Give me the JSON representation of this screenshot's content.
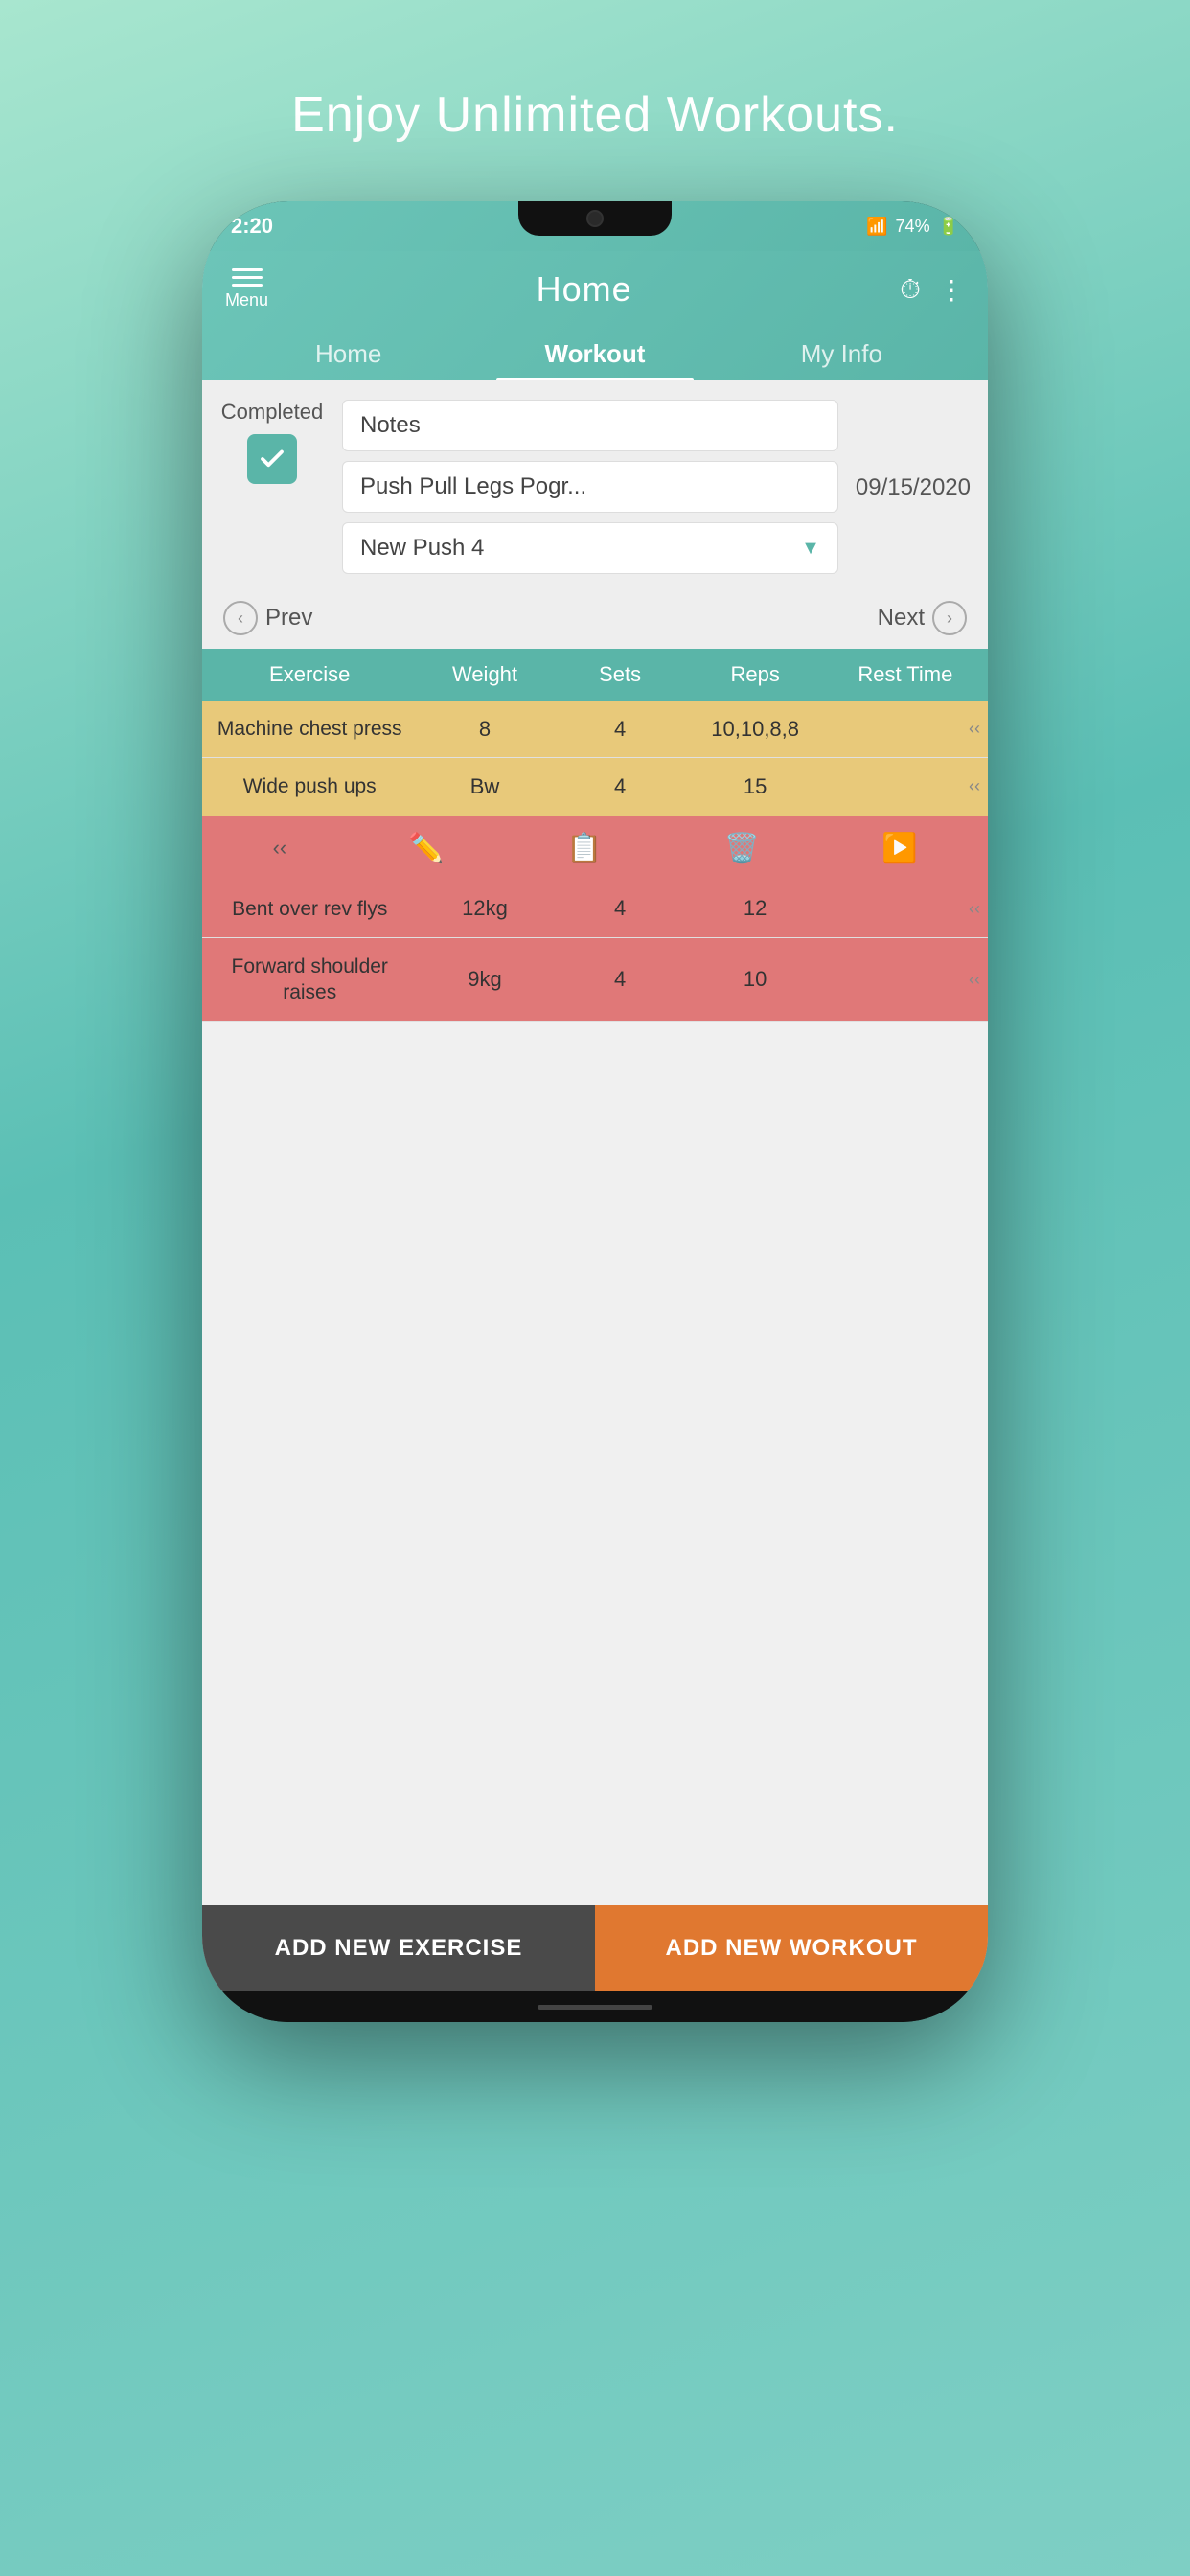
{
  "tagline": "Enjoy Unlimited Workouts.",
  "status": {
    "time": "2:20",
    "battery": "74%",
    "icons": "📶"
  },
  "header": {
    "menu_label": "Menu",
    "title": "Home",
    "timer_icon": "⏱",
    "more_icon": "⋮"
  },
  "tabs": [
    {
      "label": "Home",
      "active": false
    },
    {
      "label": "Workout",
      "active": true
    },
    {
      "label": "My Info",
      "active": false
    }
  ],
  "workout": {
    "completed_label": "Completed",
    "notes_label": "Notes",
    "program_label": "Push Pull Legs Pogr...",
    "workout_name": "New Push 4",
    "date": "09/15/2020",
    "prev_label": "Prev",
    "next_label": "Next"
  },
  "table": {
    "headers": [
      "Exercise",
      "Weight",
      "Sets",
      "Reps",
      "Rest Time"
    ],
    "rows": [
      {
        "exercise": "Machine chest press",
        "weight": "8",
        "sets": "4",
        "reps": "10,10,8,8",
        "color": "yellow"
      },
      {
        "exercise": "Wide push ups",
        "weight": "Bw",
        "sets": "4",
        "reps": "15",
        "color": "yellow"
      },
      {
        "exercise": "Bent over rev flys",
        "weight": "12kg",
        "sets": "4",
        "reps": "12",
        "color": "red"
      },
      {
        "exercise": "Forward shoulder raises",
        "weight": "9kg",
        "sets": "4",
        "reps": "10",
        "color": "red"
      }
    ]
  },
  "bottom_buttons": {
    "add_exercise": "ADD NEW EXERCISE",
    "add_workout": "ADD NEW WORKOUT"
  }
}
